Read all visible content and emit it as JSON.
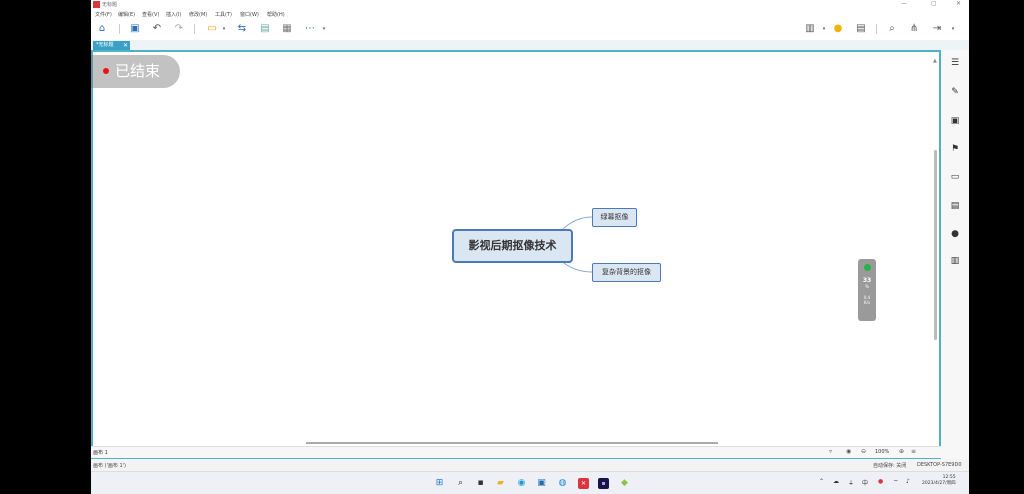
{
  "window": {
    "title": "无标题"
  },
  "menu": [
    "文件(F)",
    "编辑(E)",
    "查看(V)",
    "插入(I)",
    "修改(M)",
    "工具(T)",
    "窗口(W)",
    "帮助(H)"
  ],
  "tab": {
    "label": "*无标题",
    "close": "✕"
  },
  "overlay": {
    "status_text": "已结束"
  },
  "mindmap": {
    "central": "影视后期抠像技术",
    "children": [
      "绿幕抠像",
      "复杂背景的抠像"
    ]
  },
  "statusbar": {
    "sheet": "画布 1",
    "zoom": "100%"
  },
  "bottombar": {
    "left": "画布 ('画布 1')",
    "autosave": "自动保存: 关闭",
    "device": "DESKTOP-S7E9D0"
  },
  "perf": {
    "value1": "33",
    "unit1": "%",
    "value2": "0.4",
    "unit2": "K/s"
  },
  "taskbar": {
    "time": "12:55",
    "date": "2023/4/27/周四",
    "lang": "中"
  },
  "colors": {
    "accent": "#3aa0c6",
    "node_border": "#4a7ab8",
    "node_fill": "#dbe6f3"
  }
}
